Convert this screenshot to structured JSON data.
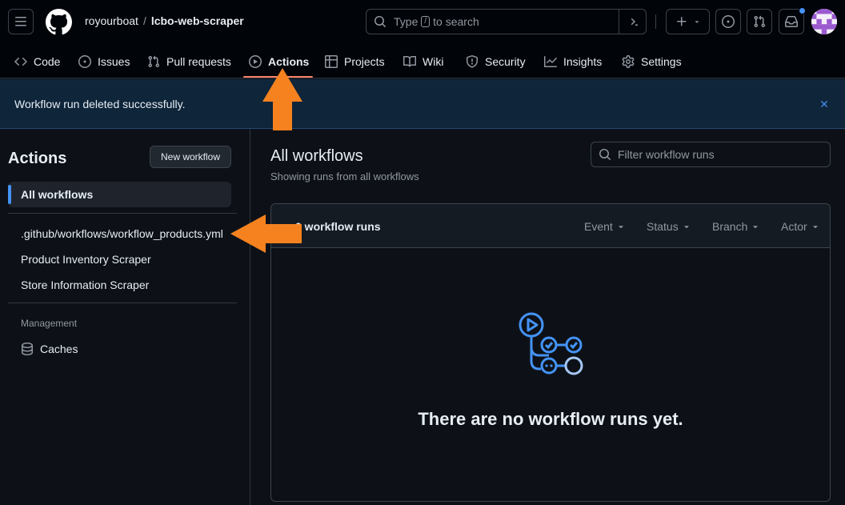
{
  "header": {
    "owner": "royourboat",
    "separator": "/",
    "repo": "lcbo-web-scraper",
    "search": {
      "prefix": "Type",
      "key": "/",
      "suffix": "to search"
    }
  },
  "tabs": [
    {
      "label": "Code",
      "icon": "code-icon"
    },
    {
      "label": "Issues",
      "icon": "issue-icon"
    },
    {
      "label": "Pull requests",
      "icon": "pull-request-icon"
    },
    {
      "label": "Actions",
      "icon": "play-icon",
      "active": true
    },
    {
      "label": "Projects",
      "icon": "table-icon"
    },
    {
      "label": "Wiki",
      "icon": "book-icon"
    },
    {
      "label": "Security",
      "icon": "shield-icon"
    },
    {
      "label": "Insights",
      "icon": "graph-icon"
    },
    {
      "label": "Settings",
      "icon": "gear-icon"
    }
  ],
  "flash": {
    "message": "Workflow run deleted successfully."
  },
  "sidebar": {
    "title": "Actions",
    "new_workflow_label": "New workflow",
    "all_workflows_label": "All workflows",
    "workflows": [
      ".github/workflows/workflow_products.yml",
      "Product Inventory Scraper",
      "Store Information Scraper"
    ],
    "management_heading": "Management",
    "caches_label": "Caches"
  },
  "main": {
    "title": "All workflows",
    "subtitle": "Showing runs from all workflows",
    "filter_placeholder": "Filter workflow runs",
    "runs_label": "0 workflow runs",
    "filters": [
      "Event",
      "Status",
      "Branch",
      "Actor"
    ],
    "empty_message": "There are no workflow runs yet."
  },
  "colors": {
    "accent": "#4493f8",
    "tab_underline": "#f78166",
    "annotation_arrow": "#f5821f"
  }
}
